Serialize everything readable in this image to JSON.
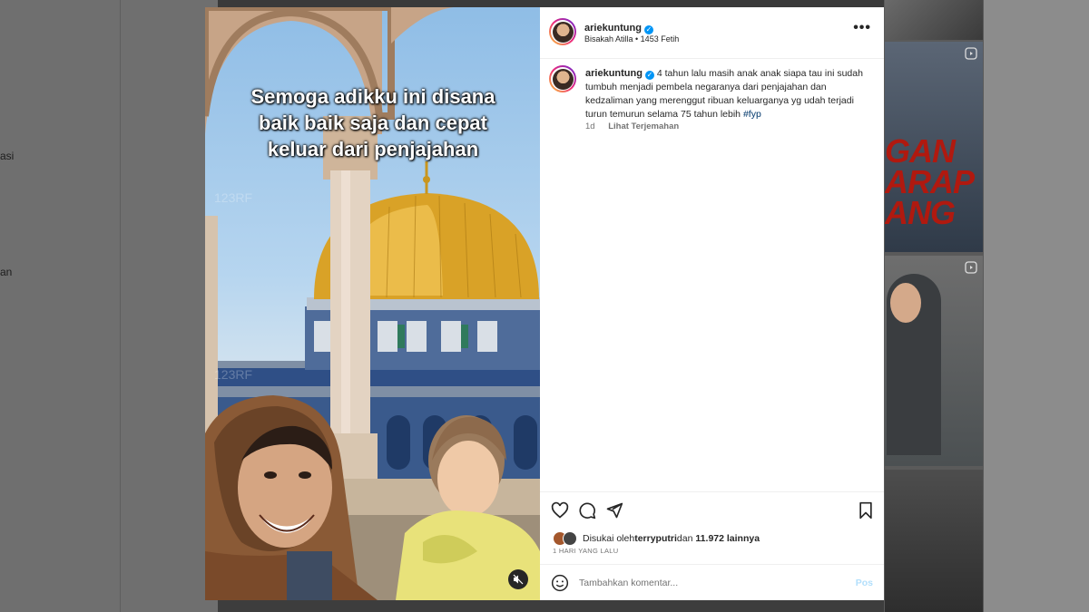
{
  "background": {
    "left_fragments": [
      "asi",
      "an"
    ],
    "right_thumb_text": [
      "GAN",
      "ARAP",
      "ANG"
    ]
  },
  "post": {
    "media": {
      "caption_lines": [
        "Semoga adikku ini disana",
        "baik baik saja dan cepat",
        "keluar dari penjajahan"
      ],
      "mute_icon": "speaker-muted-icon"
    },
    "header": {
      "username": "ariekuntung",
      "audio": "Bisakah Atilla • 1453 Fetih",
      "more_icon": "•••"
    },
    "caption": {
      "username": "ariekuntung",
      "text": "4 tahun lalu masih anak anak siapa tau ini sudah tumbuh menjadi pembela negaranya dari penjajahan dan kedzaliman yang merenggut ribuan keluarganya yg udah terjadi turun temurun selama 75 tahun lebih",
      "hashtag": "#fyp",
      "age": "1d",
      "translate": "Lihat Terjemahan"
    },
    "likes": {
      "prefix": "Disukai oleh",
      "user": "terryputri",
      "middle": "dan",
      "count": "11.972 lainnya"
    },
    "date": "1 HARI YANG LALU",
    "comment": {
      "placeholder": "Tambahkan komentar...",
      "post_label": "Pos"
    },
    "colors": {
      "verified": "#0095f6",
      "link": "#00376b",
      "muted": "#737373"
    }
  }
}
